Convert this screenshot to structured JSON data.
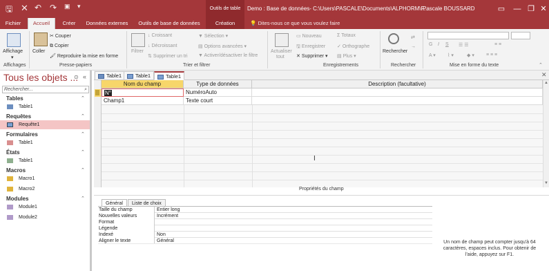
{
  "titlebar": {
    "context_group": "Outils de table",
    "title": "Demo : Base de données- C:\\Users\\PASCALE\\Documents\\ALPHORM\\F...",
    "user": "Pascale BOUSSARD",
    "buttons": {
      "minimize": "—",
      "restore": "❐",
      "close": "✕"
    }
  },
  "tabs": [
    {
      "label": "Fichier"
    },
    {
      "label": "Accueil"
    },
    {
      "label": "Créer"
    },
    {
      "label": "Données externes"
    },
    {
      "label": "Outils de base de données"
    },
    {
      "label": "Création"
    }
  ],
  "tellme": "Dites-nous ce que vous voulez faire",
  "ribbon": {
    "affichage": {
      "label": "Affichage",
      "group": "Affichages"
    },
    "coller": {
      "label": "Coller",
      "couper": "Couper",
      "copier": "Copier",
      "reproduire": "Reproduire la mise en forme",
      "group": "Presse-papiers"
    },
    "filtrer": {
      "label": "Filtrer",
      "croissant": "Croissant",
      "decroissant": "Décroissant",
      "supprimer_tri": "Supprimer un tri",
      "selection": "Sélection",
      "options_avancees": "Options avancées",
      "activer": "Activer/désactiver le filtre",
      "group": "Trier et filtrer"
    },
    "actualiser": {
      "label1": "Actualiser",
      "label2": "tout",
      "nouveau": "Nouveau",
      "enregistrer": "Enregistrer",
      "supprimer": "Supprimer",
      "totaux": "Totaux",
      "orthographe": "Orthographe",
      "plus": "Plus",
      "group": "Enregistrements"
    },
    "rechercher": {
      "label": "Rechercher",
      "group": "Rechercher"
    },
    "miseenforme": {
      "group": "Mise en forme du texte"
    }
  },
  "nav": {
    "title": "Tous les objets ...",
    "search_placeholder": "Rechercher...",
    "sections": [
      {
        "label": "Tables",
        "items": [
          "Table1"
        ]
      },
      {
        "label": "Requêtes",
        "items": [
          "Requête1"
        ]
      },
      {
        "label": "Formulaires",
        "items": [
          "Table1"
        ]
      },
      {
        "label": "États",
        "items": [
          "Table1"
        ]
      },
      {
        "label": "Macros",
        "items": [
          "Macro1",
          "Macro2"
        ]
      },
      {
        "label": "Modules",
        "items": [
          "Module1",
          "Module2"
        ]
      }
    ],
    "selected_item": "Requête1"
  },
  "doc_tabs": [
    "Table1",
    "Table1",
    "Table1"
  ],
  "grid": {
    "headers": [
      "Nom du champ",
      "Type de données",
      "Description (facultative)"
    ],
    "rows": [
      {
        "name": "N°",
        "type": "NuméroAuto",
        "desc": ""
      },
      {
        "name": "Champ1",
        "type": "Texte court",
        "desc": ""
      }
    ]
  },
  "properties": {
    "title": "Propriétés du champ",
    "tabs": [
      "Général",
      "Liste de choix"
    ],
    "rows": [
      {
        "label": "Taille du champ",
        "value": "Entier long"
      },
      {
        "label": "Nouvelles valeurs",
        "value": "Incrément"
      },
      {
        "label": "Format",
        "value": ""
      },
      {
        "label": "Légende",
        "value": ""
      },
      {
        "label": "Indexé",
        "value": "Non"
      },
      {
        "label": "Aligner le texte",
        "value": "Général"
      }
    ],
    "help": "Un nom de champ peut compter jusqu'à 64 caractères, espaces inclus. Pour obtenir de l'aide, appuyez sur F1."
  },
  "colors": {
    "brand": "#a4373a",
    "selected_header": "#f7d66a",
    "nav_selected": "#f4c5c5"
  }
}
